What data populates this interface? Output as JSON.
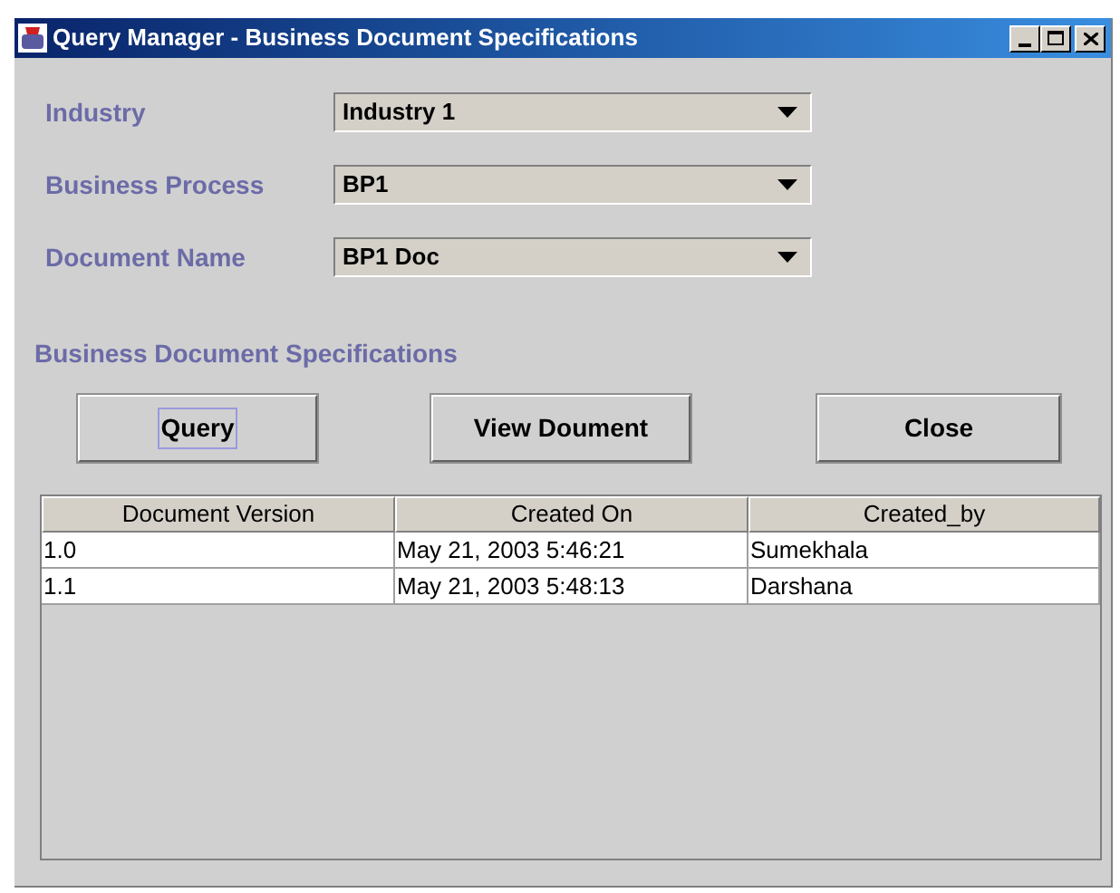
{
  "window": {
    "title": "Query Manager - Business Document Specifications"
  },
  "fields": [
    {
      "label": "Industry",
      "value": "Industry 1"
    },
    {
      "label": "Business Process",
      "value": "BP1"
    },
    {
      "label": "Document Name",
      "value": "BP1 Doc"
    }
  ],
  "section_title": "Business Document Specifications",
  "buttons": [
    {
      "label": "Query",
      "focused": true
    },
    {
      "label": "View Doument",
      "focused": false
    },
    {
      "label": "Close",
      "focused": false
    }
  ],
  "table": {
    "columns": [
      "Document Version",
      "Created On",
      "Created_by"
    ],
    "rows": [
      [
        "1.0",
        "May 21, 2003 5:46:21",
        "Sumekhala"
      ],
      [
        "1.1",
        "May 21, 2003 5:48:13",
        "Darshana"
      ]
    ]
  }
}
